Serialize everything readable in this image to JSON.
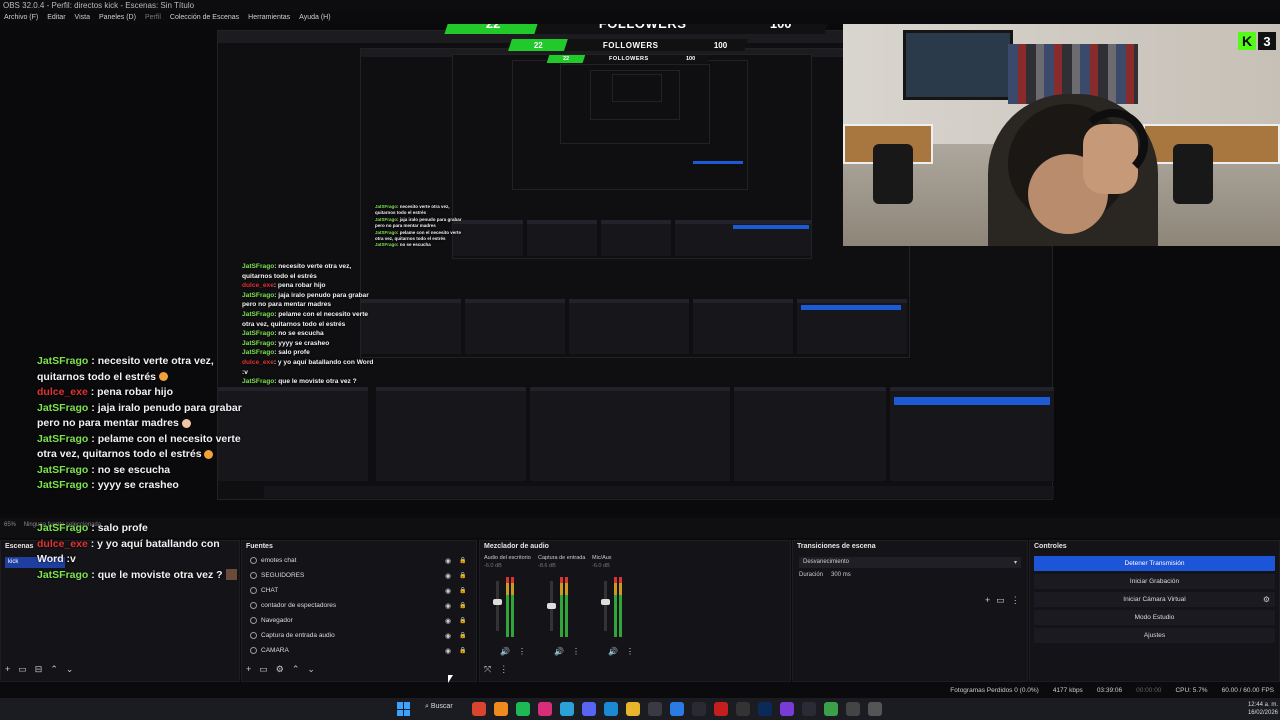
{
  "window": {
    "title": "OBS 32.0.4 - Perfil: directos kick - Escenas: Sin Título",
    "menu": [
      "Archivo (F)",
      "Editar",
      "Vista",
      "Paneles (D)",
      "Perfil",
      "Colección de Escenas",
      "Herramientas",
      "Ayuda (H)"
    ]
  },
  "overlay": {
    "followers_current": "22",
    "followers_label": "FOLLOWERS",
    "followers_goal": "100",
    "kick_letter": "K",
    "kick_number": "3"
  },
  "chat": [
    {
      "user": "JatSFrago",
      "message": "necesito verte otra vez, quitarnos todo el estrés",
      "emoji": true,
      "red": false
    },
    {
      "user": "dulce_exe",
      "message": "pena robar hijo",
      "emoji": false,
      "red": true
    },
    {
      "user": "JatSFrago",
      "message": "jaja iralo penudo para grabar pero no para mentar madres",
      "emoji": true,
      "red": false
    },
    {
      "user": "JatSFrago",
      "message": "pelame con el necesito verte otra vez, quitarnos todo el estrés",
      "emoji": true,
      "red": false
    },
    {
      "user": "JatSFrago",
      "message": "no se escucha",
      "emoji": false,
      "red": false
    },
    {
      "user": "JatSFrago",
      "message": "yyyy se crasheo",
      "emoji": false,
      "red": false
    },
    {
      "user": "JatSFrago",
      "message": "salo profe",
      "emoji": false,
      "red": false
    }
  ],
  "chat_bottom": [
    {
      "user": "dulce_exe",
      "message": "y yo aquí batallando con Word :v",
      "red": true
    },
    {
      "user": "JatSFrago",
      "message": "que le moviste otra vez ?",
      "red": false
    }
  ],
  "statusline": {
    "zoom": "65%",
    "filters": "Ninguna fuente seleccionada"
  },
  "docks": {
    "scenes": {
      "title": "Escenas",
      "items": [
        "kick"
      ]
    },
    "sources": {
      "title": "Fuentes",
      "items": [
        "emotes chat",
        "SEGUIDORES",
        "CHAT",
        "contador de espectadores",
        "Navegador",
        "Captura de entrada audio",
        "CAMARA"
      ]
    },
    "mixer": {
      "title": "Mezclador de audio",
      "channels": [
        {
          "name": "Audio del escritorio",
          "db": "-6.0 dB"
        },
        {
          "name": "Captura de entrada",
          "db": "-8.6 dB"
        },
        {
          "name": "Mic/Aux",
          "db": "-6.0 dB"
        }
      ]
    },
    "transitions": {
      "title": "Transiciones de escena",
      "selected": "Desvanecimiento",
      "duration_label": "Duración",
      "duration_value": "300 ms"
    },
    "controls": {
      "title": "Controles",
      "buttons": [
        "Detener Transmisión",
        "Iniciar Grabación",
        "Iniciar Cámara Virtual",
        "Modo Estudio",
        "Ajustes"
      ]
    }
  },
  "statusbar": {
    "frames": "Fotogramas Perdidos 0 (0.0%)",
    "bitrate": "4177 kbps",
    "stream_time": "03:39:06",
    "rec_time": "00:00:00",
    "cpu": "CPU: 5.7%",
    "fps": "60.00 / 60.00 FPS"
  },
  "taskbar": {
    "search": "Buscar",
    "time": "12:44 a. m.",
    "date": "16/02/2026"
  },
  "colors": {
    "accent_blue": "#1c55d8",
    "kick_green": "#53fc18",
    "chat_user": "#7ee34f",
    "chat_red": "#e23333"
  }
}
